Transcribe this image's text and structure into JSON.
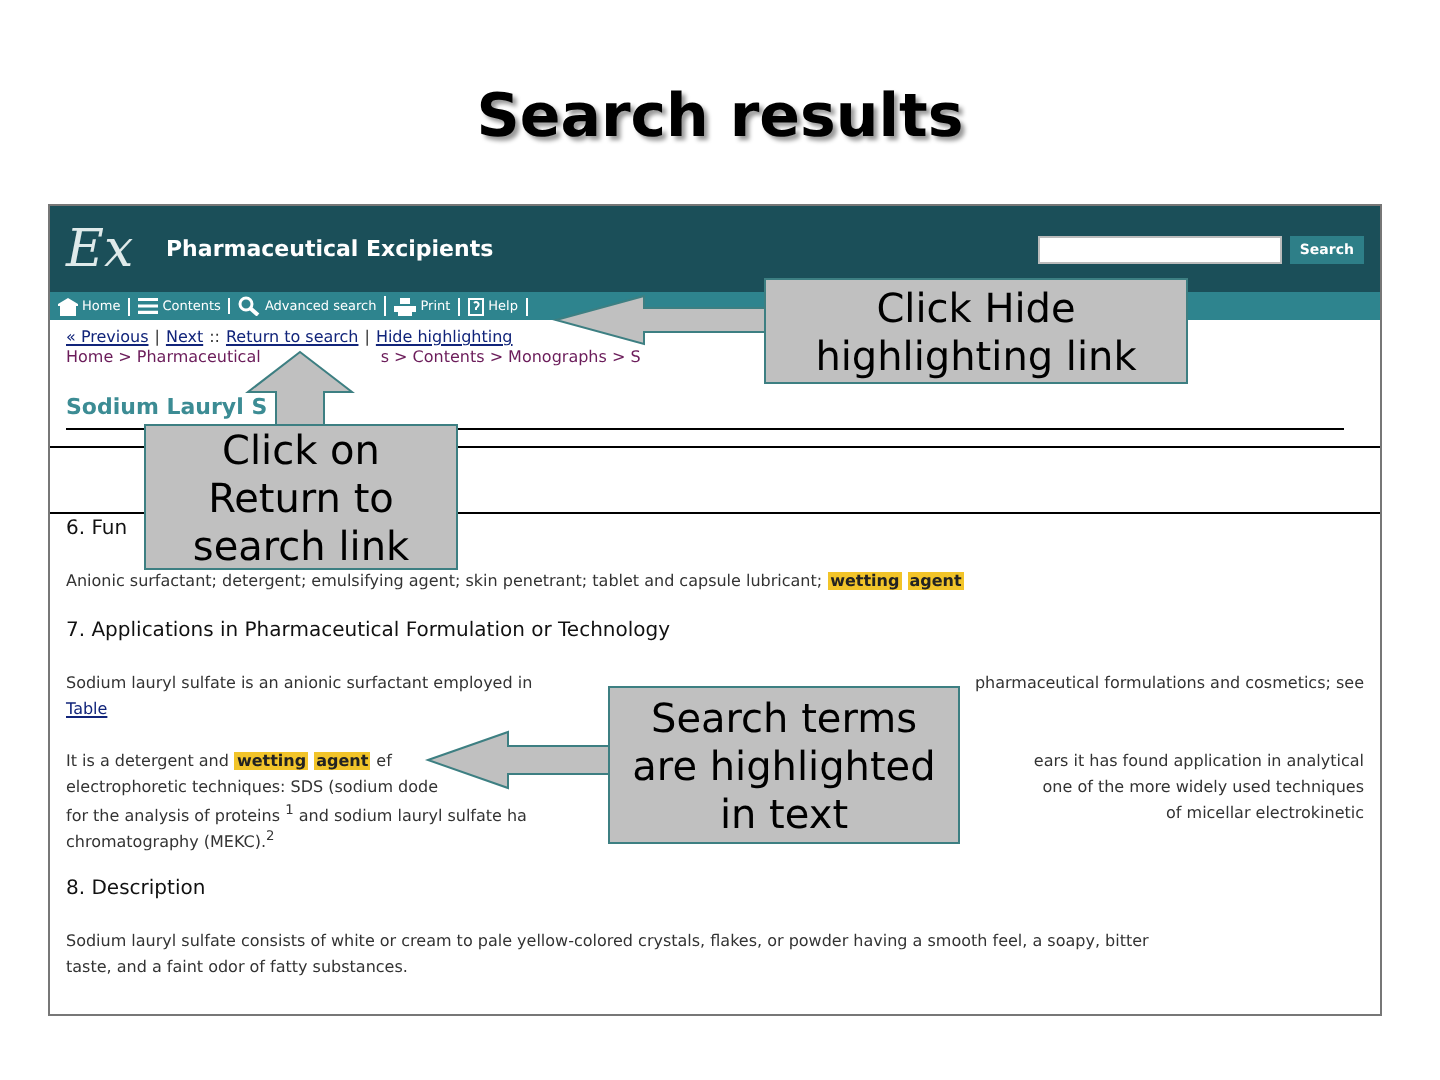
{
  "slide_title": "Search results",
  "site": {
    "logo": "Ex",
    "title": "Pharmaceutical Excipients",
    "search_button": "Search",
    "toolbar": [
      {
        "kind": "home",
        "label": "Home"
      },
      {
        "kind": "contents",
        "label": "Contents"
      },
      {
        "kind": "search",
        "label": "Advanced search"
      },
      {
        "kind": "print",
        "label": "Print"
      },
      {
        "kind": "help",
        "label": "Help"
      }
    ],
    "nav": [
      {
        "kind": "link",
        "text": "« Previous"
      },
      {
        "kind": "sep",
        "text": "|"
      },
      {
        "kind": "link",
        "text": "Next"
      },
      {
        "kind": "sep",
        "text": "::"
      },
      {
        "kind": "link",
        "text": "Return to search"
      },
      {
        "kind": "sep",
        "text": "|"
      },
      {
        "kind": "link",
        "text": "Hide highlighting"
      }
    ],
    "breadcrumb": [
      "Home > Pharmaceutical",
      "s > Contents > Monographs > S"
    ],
    "heading": "Sodium Lauryl S",
    "sections": [
      {
        "heading": "6. Fun",
        "lines": [
          {
            "left": [
              {
                "text": "Anionic surfactant; detergent; emulsifying agent; skin penetrant; tablet and capsule lubricant;",
                "highlighted": false
              },
              {
                "text": "wetting",
                "highlighted": true
              },
              {
                "text": "agent",
                "highlighted": true
              }
            ]
          }
        ]
      },
      {
        "heading": "7. Applications in Pharmaceutical Formulation or Technology",
        "lines": [
          {
            "left": [
              {
                "text": "Sodium lauryl sulfate is an anionic surfactant employed in",
                "highlighted": false
              }
            ],
            "right": "pharmaceutical formulations and cosmetics; see"
          },
          {
            "link": "Table"
          },
          {
            "left": [
              {
                "text": "It is a detergent and",
                "highlighted": false
              },
              {
                "text": "wetting",
                "highlighted": true
              },
              {
                "text": "agent",
                "highlighted": true
              },
              {
                "text": "ef",
                "highlighted": false
              }
            ],
            "right": "ears it has found application in analytical"
          },
          {
            "left": [
              {
                "text": "electrophoretic techniques: SDS (sodium dode",
                "highlighted": false
              }
            ],
            "right": "one of the more widely used techniques"
          },
          {
            "left": [
              {
                "text": "for the analysis of proteins $^{1}$ and sodium lauryl sulfate ha",
                "highlighted": false
              }
            ],
            "right": "of micellar electrokinetic"
          },
          {
            "left": [
              {
                "text": "chromatography (MEKC).$^{2}$",
                "highlighted": false
              }
            ]
          }
        ]
      },
      {
        "heading": "8. Description",
        "lines": [
          {
            "left": [
              {
                "text": "Sodium lauryl sulfate consists of white or cream to pale yellow-colored crystals, flakes, or powder having a smooth feel, a soapy, bitter",
                "highlighted": false
              }
            ]
          },
          {
            "left": [
              {
                "text": "taste, and a faint odor of fatty substances.",
                "highlighted": false
              }
            ]
          }
        ]
      }
    ]
  },
  "callouts": [
    {
      "text": "Click Hide highlighting link"
    },
    {
      "text": "Click on Return to search link"
    },
    {
      "text": "Search terms are highlighted in text"
    }
  ]
}
